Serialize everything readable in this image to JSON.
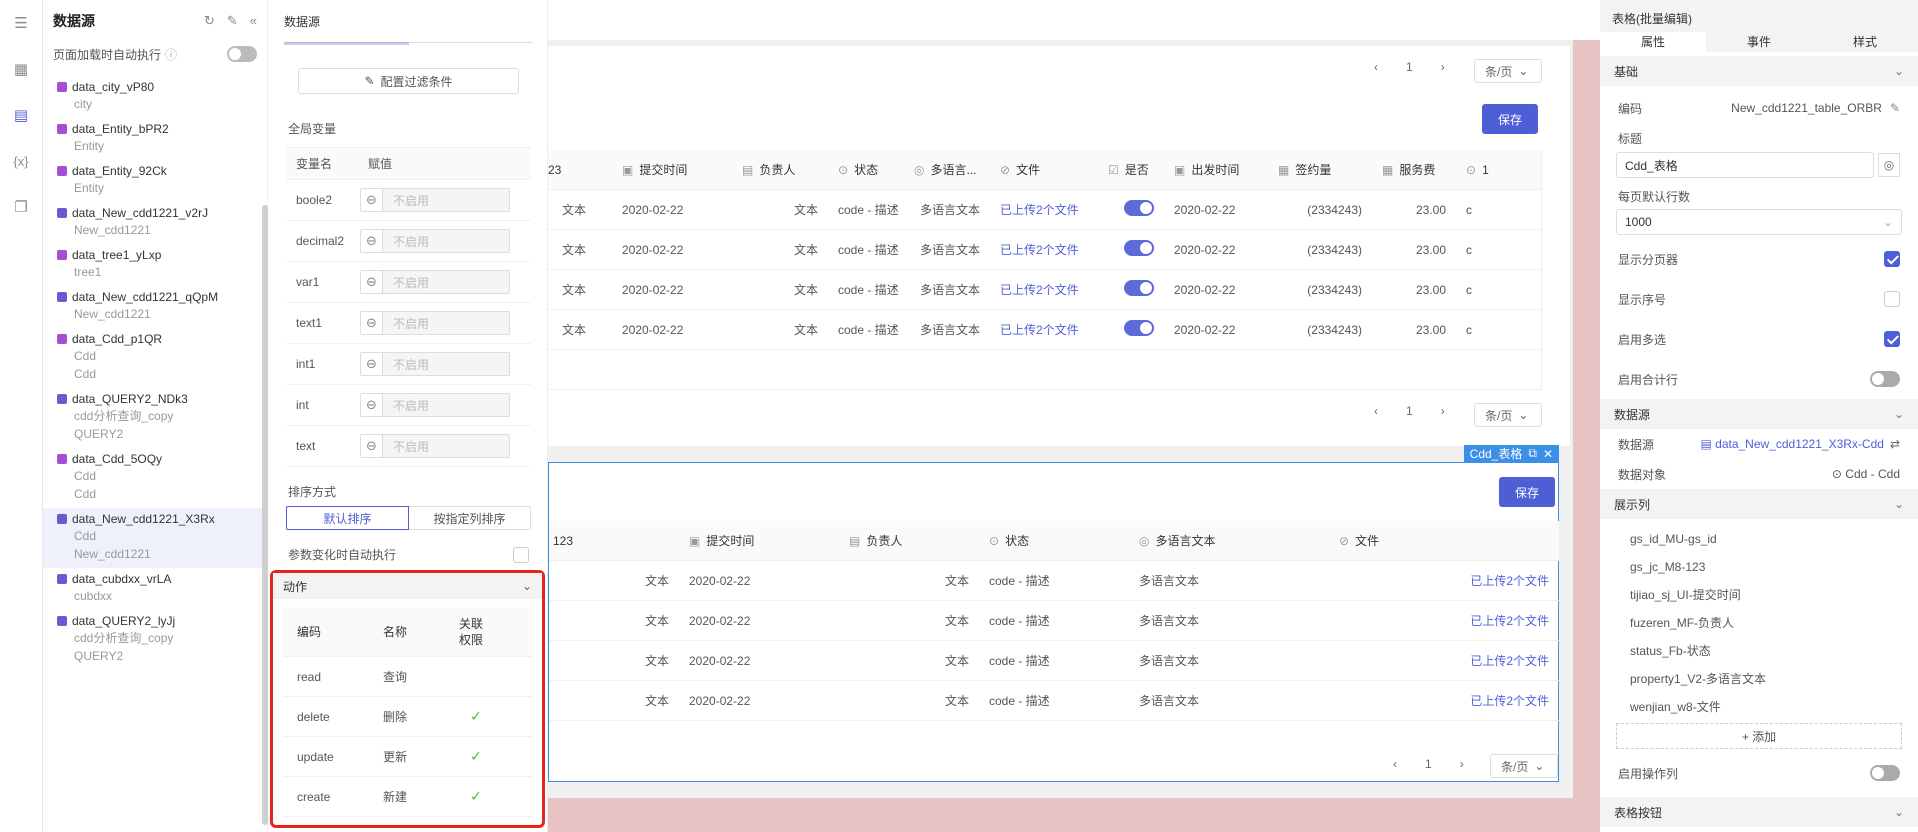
{
  "rail": {
    "icons": [
      "layers-icon",
      "grid-icon",
      "database-icon",
      "variable-icon",
      "page-icon"
    ]
  },
  "datasource": {
    "title": "数据源",
    "auto_exec_label": "页面加载时自动执行",
    "items": [
      {
        "name": "data_city_vP80",
        "lines": [
          "city"
        ],
        "icon": "table-icon",
        "color": "#a64dd6"
      },
      {
        "name": "data_Entity_bPR2",
        "lines": [
          "Entity"
        ],
        "icon": "table-icon",
        "color": "#a64dd6"
      },
      {
        "name": "data_Entity_92Ck",
        "lines": [
          "Entity"
        ],
        "icon": "table-icon",
        "color": "#a64dd6"
      },
      {
        "name": "data_New_cdd1221_v2rJ",
        "lines": [
          "New_cdd1221"
        ],
        "icon": "cube-icon",
        "color": "#6a5acd"
      },
      {
        "name": "data_tree1_yLxp",
        "lines": [
          "tree1"
        ],
        "icon": "table-icon",
        "color": "#a64dd6"
      },
      {
        "name": "data_New_cdd1221_qQpM",
        "lines": [
          "New_cdd1221"
        ],
        "icon": "cube-icon",
        "color": "#6a5acd"
      },
      {
        "name": "data_Cdd_p1QR",
        "lines": [
          "Cdd",
          "Cdd"
        ],
        "icon": "table-icon",
        "color": "#a64dd6"
      },
      {
        "name": "data_QUERY2_NDk3",
        "lines": [
          "cdd分析查询_copy",
          "QUERY2"
        ],
        "icon": "query-icon",
        "color": "#6a5acd"
      },
      {
        "name": "data_Cdd_5OQy",
        "lines": [
          "Cdd",
          "Cdd"
        ],
        "icon": "table-icon",
        "color": "#a64dd6"
      },
      {
        "name": "data_New_cdd1221_X3Rx",
        "lines": [
          "Cdd",
          "New_cdd1221"
        ],
        "icon": "cube-icon",
        "color": "#6a5acd",
        "selected": true
      },
      {
        "name": "data_cubdxx_vrLA",
        "lines": [
          "cubdxx"
        ],
        "icon": "stack-icon",
        "color": "#6a5acd"
      },
      {
        "name": "data_QUERY2_lyJj",
        "lines": [
          "cdd分析查询_copy",
          "QUERY2"
        ],
        "icon": "query-icon",
        "color": "#6a5acd"
      }
    ]
  },
  "panel": {
    "title": "数据源",
    "filter_button": "配置过滤条件",
    "globals_label": "全局变量",
    "col_name": "变量名",
    "col_value": "赋值",
    "var_placeholder": "不启用",
    "vars": [
      "boole2",
      "decimal2",
      "var1",
      "text1",
      "int1",
      "int",
      "text"
    ],
    "sort_label": "排序方式",
    "sort_default": "默认排序",
    "sort_custom": "按指定列排序",
    "param_auto": "参数变化时自动执行",
    "actions_title": "动作",
    "act_cols": [
      "编码",
      "名称",
      "关联权限"
    ],
    "actions": [
      {
        "code": "read",
        "name": "查询",
        "perm": ""
      },
      {
        "code": "delete",
        "name": "删除",
        "perm": "✓"
      },
      {
        "code": "update",
        "name": "更新",
        "perm": "✓"
      },
      {
        "code": "create",
        "name": "新建",
        "perm": "✓"
      }
    ]
  },
  "table1": {
    "page": "1",
    "per_page": "条/页",
    "save": "保存",
    "headers": [
      "23",
      "提交时间",
      "负责人",
      "状态",
      "多语言...",
      "文件",
      "是否",
      "出发时间",
      "签约量",
      "服务费",
      "1"
    ],
    "rows": [
      [
        "文本",
        "2020-02-22",
        "文本",
        "code - 描述",
        "多语言文本",
        "已上传2个文件",
        "",
        "2020-02-22",
        "(2334243)",
        "23.00",
        "c"
      ],
      [
        "文本",
        "2020-02-22",
        "文本",
        "code - 描述",
        "多语言文本",
        "已上传2个文件",
        "",
        "2020-02-22",
        "(2334243)",
        "23.00",
        "c"
      ],
      [
        "文本",
        "2020-02-22",
        "文本",
        "code - 描述",
        "多语言文本",
        "已上传2个文件",
        "",
        "2020-02-22",
        "(2334243)",
        "23.00",
        "c"
      ],
      [
        "文本",
        "2020-02-22",
        "文本",
        "code - 描述",
        "多语言文本",
        "已上传2个文件",
        "",
        "2020-02-22",
        "(2334243)",
        "23.00",
        "c"
      ]
    ]
  },
  "table2": {
    "tag": "Cdd_表格",
    "page": "1",
    "per_page": "条/页",
    "save": "保存",
    "headers": [
      "123",
      "提交时间",
      "负责人",
      "状态",
      "多语言文本",
      "文件"
    ],
    "rows": [
      [
        "文本",
        "2020-02-22",
        "文本",
        "code - 描述",
        "多语言文本",
        "已上传2个文件"
      ],
      [
        "文本",
        "2020-02-22",
        "文本",
        "code - 描述",
        "多语言文本",
        "已上传2个文件"
      ],
      [
        "文本",
        "2020-02-22",
        "文本",
        "code - 描述",
        "多语言文本",
        "已上传2个文件"
      ],
      [
        "文本",
        "2020-02-22",
        "文本",
        "code - 描述",
        "多语言文本",
        "已上传2个文件"
      ]
    ]
  },
  "props": {
    "title": "表格(批量编辑)",
    "tabs": [
      "属性",
      "事件",
      "样式"
    ],
    "basic": "基础",
    "code_label": "编码",
    "code_value": "New_cdd1221_table_ORBR",
    "title_label": "标题",
    "title_value": "Cdd_表格",
    "pagesize_label": "每页默认行数",
    "pagesize_value": "1000",
    "show_pager": "显示分页器",
    "show_index": "显示序号",
    "multi": "启用多选",
    "summary": "启用合计行",
    "ds_section": "数据源",
    "ds_label": "数据源",
    "ds_value": "data_New_cdd1221_X3Rx-Cdd",
    "obj_label": "数据对象",
    "obj_value": "Cdd - Cdd",
    "cols_section": "展示列",
    "columns": [
      "gs_id_MU-gs_id",
      "gs_jc_M8-123",
      "tijiao_sj_UI-提交时间",
      "fuzeren_MF-负责人",
      "status_Fb-状态",
      "property1_V2-多语言文本",
      "wenjian_w8-文件"
    ],
    "add": "+ 添加",
    "op_col": "启用操作列",
    "btn_section": "表格按钮"
  }
}
